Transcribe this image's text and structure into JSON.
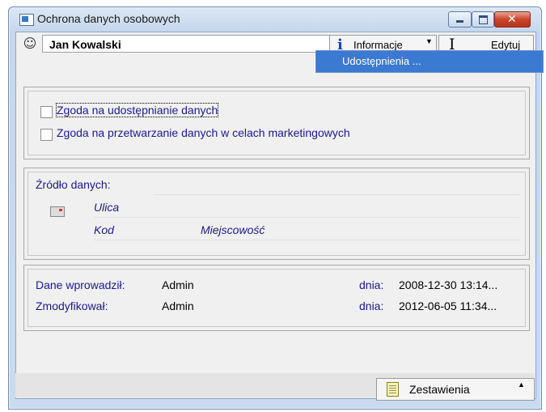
{
  "window": {
    "title": "Ochrona danych osobowych",
    "close_glyph": "✕"
  },
  "toolbar": {
    "person_name": "Jan Kowalski",
    "info_label": "Informacje",
    "edit_label": "Edytuj"
  },
  "dropdown_menu": {
    "items": [
      "Udostępnienia ..."
    ]
  },
  "consents": {
    "items": [
      {
        "label": "Zgoda na udostępnianie danych",
        "checked": false
      },
      {
        "label": "Zgoda na przetwarzanie danych w celach marketingowych",
        "checked": false
      }
    ]
  },
  "source": {
    "label": "Źródło danych:",
    "street_label": "Ulica",
    "postcode_label": "Kod",
    "city_label": "Miejscowość"
  },
  "audit": {
    "created_label": "Dane wprowadził:",
    "created_by": "Admin",
    "created_date_label": "dnia:",
    "created_date": "2008-12-30 13:14...",
    "modified_label": "Zmodyfikował:",
    "modified_by": "Admin",
    "modified_date_label": "dnia:",
    "modified_date": "2012-06-05 11:34..."
  },
  "footer": {
    "summary_label": "Zestawienia"
  },
  "icons": {
    "app": "app-window-icon",
    "person": "person-icon",
    "info": "info-icon",
    "edit": "text-cursor-icon",
    "envelope": "envelope-icon",
    "document": "document-icon"
  },
  "colors": {
    "label_text": "#1a1a8c",
    "menu_highlight": "#3a7ad0",
    "close_button": "#c9462c"
  }
}
